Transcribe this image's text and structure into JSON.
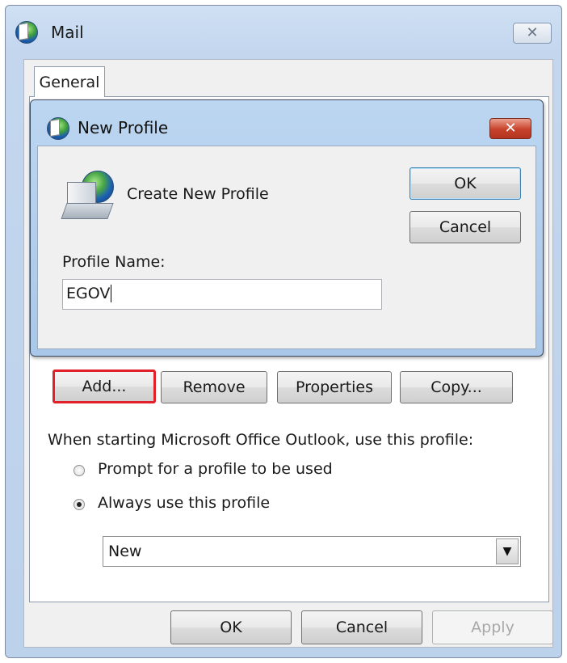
{
  "window": {
    "title": "Mail",
    "close_icon": "close-icon"
  },
  "tabs": [
    {
      "label": "General"
    }
  ],
  "dialog": {
    "title": "New Profile",
    "heading": "Create New Profile",
    "ok_label": "OK",
    "cancel_label": "Cancel",
    "profile_name_label": "Profile Name:",
    "profile_name_value": "EGOV"
  },
  "profile_buttons": {
    "add": "Add...",
    "remove": "Remove",
    "properties": "Properties",
    "copy": "Copy..."
  },
  "startup": {
    "heading": "When starting Microsoft Office Outlook, use this profile:",
    "options": [
      {
        "label": "Prompt for a profile to be used",
        "selected": false
      },
      {
        "label": "Always use this profile",
        "selected": true
      }
    ],
    "selected_profile": "New"
  },
  "footer": {
    "ok": "OK",
    "cancel": "Cancel",
    "apply": "Apply"
  },
  "colors": {
    "highlight": "#e0202a",
    "dialog_close": "#c8412a"
  }
}
